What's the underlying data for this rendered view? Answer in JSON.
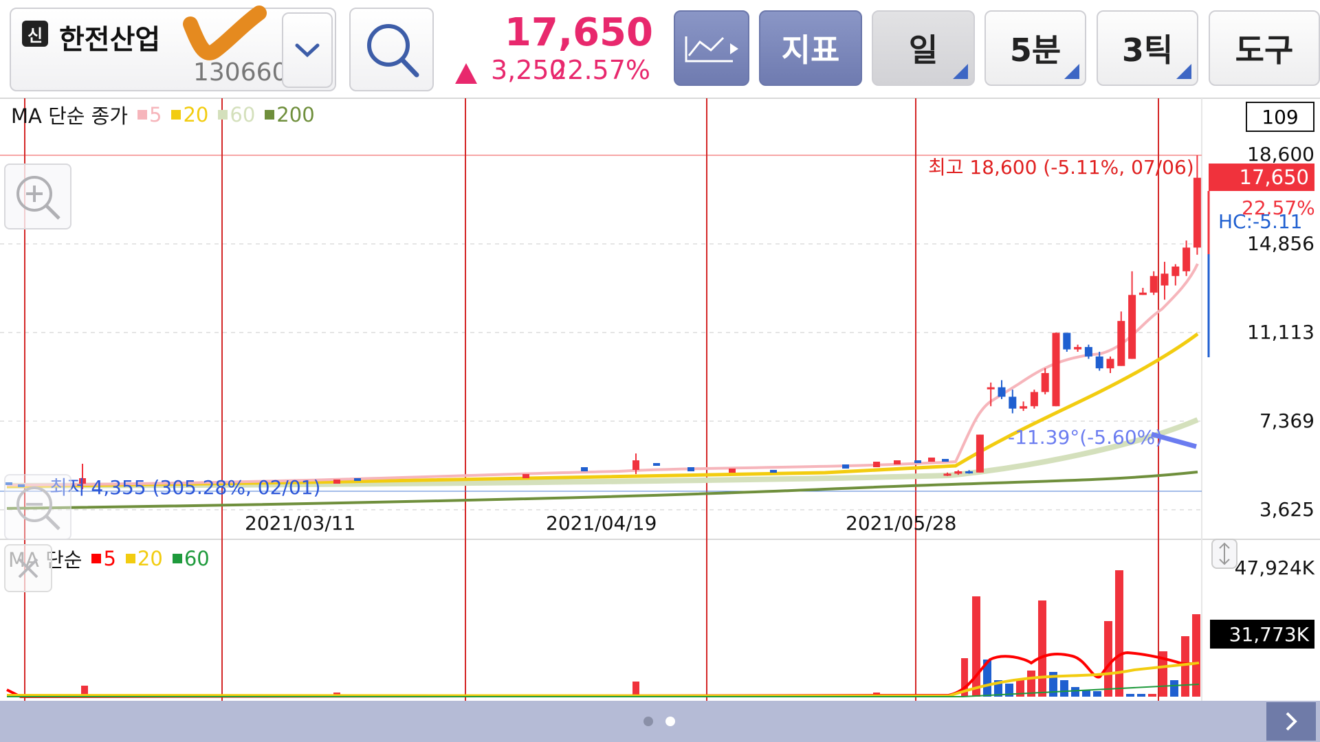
{
  "header": {
    "credit_badge": "신",
    "stock_name": "한전산업",
    "stock_code": "130660",
    "price": "17,650",
    "change_abs": "3,250",
    "change_pct": "22.57%",
    "indicator_label": "지표",
    "period_label": "일",
    "minute_label": "5분",
    "tick_label": "3틱",
    "tools_label": "도구"
  },
  "icons": {
    "check": "check-mark-icon",
    "dropdown": "chevron-down-icon",
    "search": "search-icon",
    "chart_type": "line-chart-icon",
    "zoom_in": "zoom-in-icon",
    "zoom_out": "zoom-out-icon",
    "close": "close-icon",
    "resize": "resize-vertical-icon",
    "next": "chevron-right-icon"
  },
  "colors": {
    "up": "#f0323c",
    "down": "#1f5fd0",
    "price_text": "#e8286d",
    "ma5": "#f6b5bb",
    "ma20": "#f2cc10",
    "ma60": "#d4e0bc",
    "ma200": "#6f8f3c",
    "vol_ma5": "#ff0000",
    "vol_ma20": "#f2cc10",
    "vol_ma60": "#1e9a3c",
    "accent_blue": "#6f7bb0"
  },
  "price_panel": {
    "legend_title": "MA 단순 종가",
    "legend": [
      {
        "label": "5",
        "color": "#f6b5bb"
      },
      {
        "label": "20",
        "color": "#f2cc10"
      },
      {
        "label": "60",
        "color": "#d4e0bc"
      },
      {
        "label": "200",
        "color": "#6f8f3c"
      }
    ],
    "visible_count": "109",
    "y_labels": [
      "18,600",
      "14,856",
      "11,113",
      "7,369",
      "3,625"
    ],
    "current_price_tag": "17,650",
    "current_change_tag": "22.57%",
    "hc_label": "HC:-5.11",
    "high_annotation": "최고 18,600 (-5.11%, 07/06)",
    "low_annotation": "최저 4,355 (305.28%, 02/01)",
    "angle_annotation": "-11.39°(-5.60%)",
    "date_labels": [
      "2021/03/11",
      "2021/04/19",
      "2021/05/28"
    ]
  },
  "volume_panel": {
    "legend_title": "MA 단순",
    "legend": [
      {
        "label": "5",
        "color": "#ff0000"
      },
      {
        "label": "20",
        "color": "#f2cc10"
      },
      {
        "label": "60",
        "color": "#1e9a3c"
      }
    ],
    "y_label_top": "47,924K",
    "current_volume_tag": "31,773K"
  },
  "chart_data": {
    "type": "candlestick",
    "y_range": [
      3625,
      18600
    ],
    "volume_range_k": [
      0,
      47924
    ],
    "candles_recent": [
      {
        "o": 5100,
        "h": 5200,
        "l": 5050,
        "c": 5150
      },
      {
        "o": 5150,
        "h": 5300,
        "l": 5100,
        "c": 5250
      },
      {
        "o": 5250,
        "h": 5300,
        "l": 5150,
        "c": 5200
      },
      {
        "o": 5200,
        "h": 6800,
        "l": 5200,
        "c": 6800
      },
      {
        "o": 8800,
        "h": 9000,
        "l": 8000,
        "c": 8800
      },
      {
        "o": 8800,
        "h": 9100,
        "l": 8300,
        "c": 8400
      },
      {
        "o": 8400,
        "h": 8700,
        "l": 7700,
        "c": 7900
      },
      {
        "o": 7900,
        "h": 8200,
        "l": 7800,
        "c": 8000
      },
      {
        "o": 8000,
        "h": 8700,
        "l": 7900,
        "c": 8600
      },
      {
        "o": 8600,
        "h": 9600,
        "l": 8500,
        "c": 9400
      },
      {
        "o": 8000,
        "h": 11113,
        "l": 8000,
        "c": 11100
      },
      {
        "o": 11100,
        "h": 11100,
        "l": 10300,
        "c": 10400
      },
      {
        "o": 10400,
        "h": 10600,
        "l": 10300,
        "c": 10500
      },
      {
        "o": 10500,
        "h": 10600,
        "l": 10000,
        "c": 10100
      },
      {
        "o": 10100,
        "h": 10300,
        "l": 9500,
        "c": 9600
      },
      {
        "o": 9600,
        "h": 10100,
        "l": 9400,
        "c": 10000
      },
      {
        "o": 9700,
        "h": 12000,
        "l": 9700,
        "c": 11600
      },
      {
        "o": 10000,
        "h": 13700,
        "l": 10000,
        "c": 12700
      },
      {
        "o": 12700,
        "h": 13000,
        "l": 12700,
        "c": 12800
      },
      {
        "o": 12800,
        "h": 13700,
        "l": 12700,
        "c": 13500
      },
      {
        "o": 13100,
        "h": 14100,
        "l": 12500,
        "c": 13600
      },
      {
        "o": 13500,
        "h": 14000,
        "l": 13100,
        "c": 13900
      },
      {
        "o": 13700,
        "h": 15000,
        "l": 13500,
        "c": 14700
      },
      {
        "o": 14700,
        "h": 18600,
        "l": 14400,
        "c": 17650
      }
    ]
  },
  "pagination": {
    "pages": 2,
    "active": 1
  }
}
